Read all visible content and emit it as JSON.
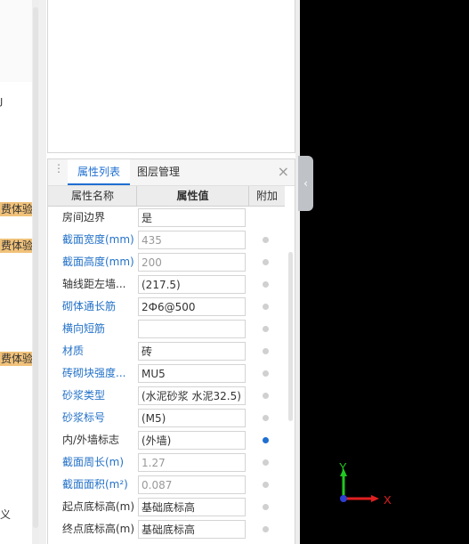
{
  "left_panel": {
    "text_1": "ȷ",
    "tags": [
      "费体验",
      "费体验",
      "费体验"
    ],
    "bottom_text": "义"
  },
  "tabs": [
    {
      "label": "属性列表",
      "active": true
    },
    {
      "label": "图层管理",
      "active": false
    }
  ],
  "close_icon": "×",
  "collapse_icon": "‹",
  "table": {
    "col_name": "属性名称",
    "col_value": "属性值",
    "col_extra": "附加",
    "rows": [
      {
        "name": "房间边界",
        "value": "是",
        "blue": false,
        "value_gray": false,
        "dot": "none"
      },
      {
        "name": "截面宽度(mm)",
        "value": "435",
        "blue": true,
        "value_gray": true,
        "dot": "gray"
      },
      {
        "name": "截面高度(mm)",
        "value": "200",
        "blue": true,
        "value_gray": true,
        "dot": "gray"
      },
      {
        "name": "轴线距左墙...",
        "value": "(217.5)",
        "blue": false,
        "value_gray": false,
        "dot": "gray"
      },
      {
        "name": "砌体通长筋",
        "value": "2Ф6@500",
        "blue": true,
        "value_gray": false,
        "dot": "gray"
      },
      {
        "name": "横向短筋",
        "value": "",
        "blue": true,
        "value_gray": false,
        "dot": "gray"
      },
      {
        "name": "材质",
        "value": "砖",
        "blue": true,
        "value_gray": false,
        "dot": "gray"
      },
      {
        "name": "砖砌块强度...",
        "value": "MU5",
        "blue": true,
        "value_gray": false,
        "dot": "gray"
      },
      {
        "name": "砂浆类型",
        "value": "(水泥砂浆 水泥32.5)",
        "blue": true,
        "value_gray": false,
        "dot": "gray"
      },
      {
        "name": "砂浆标号",
        "value": "(M5)",
        "blue": true,
        "value_gray": false,
        "dot": "gray"
      },
      {
        "name": "内/外墙标志",
        "value": "(外墙)",
        "blue": false,
        "value_gray": false,
        "dot": "blue"
      },
      {
        "name": "截面周长(m)",
        "value": "1.27",
        "blue": true,
        "value_gray": true,
        "dot": "gray"
      },
      {
        "name": "截面面积(m²)",
        "value": "0.087",
        "blue": true,
        "value_gray": true,
        "dot": "gray"
      },
      {
        "name": "起点底标高(m)",
        "value": "基础底标高",
        "blue": false,
        "value_gray": false,
        "dot": "gray"
      },
      {
        "name": "终点底标高(m)",
        "value": "基础底标高",
        "blue": false,
        "value_gray": false,
        "dot": "gray"
      }
    ]
  },
  "axis": {
    "y_label": "Y",
    "x_label": "X",
    "y_color": "#22c722",
    "x_color": "#e02020",
    "origin_color": "#2b3fd1"
  }
}
